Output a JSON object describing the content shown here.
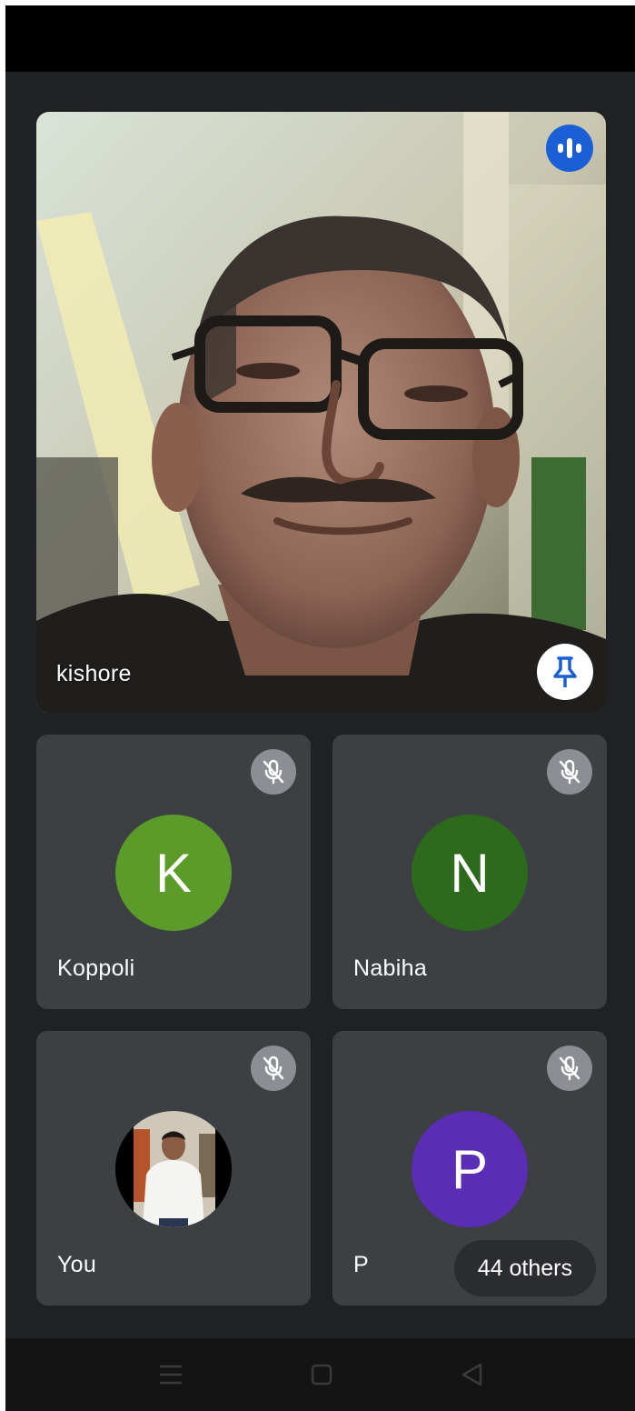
{
  "featured": {
    "name": "kishore",
    "speaking_icon": "audio-wave-icon",
    "pin_icon": "pin-icon"
  },
  "participants": [
    {
      "name": "Koppoli",
      "initial": "K",
      "avatar_color": "#5b9b2a",
      "muted_icon": "mic-off-icon"
    },
    {
      "name": "Nabiha",
      "initial": "N",
      "avatar_color": "#2d6a1c",
      "muted_icon": "mic-off-icon"
    },
    {
      "name": "You",
      "initial": "",
      "avatar_color": "#000000",
      "muted_icon": "mic-off-icon"
    },
    {
      "name": "P",
      "initial": "P",
      "avatar_color": "#5a2db4",
      "muted_icon": "mic-off-icon"
    }
  ],
  "others_chip": {
    "label": "44 others"
  },
  "nav": {
    "menu_icon": "recent-apps-icon",
    "home_icon": "home-icon",
    "back_icon": "back-icon"
  },
  "colors": {
    "background": "#202124",
    "tile": "#3c4043",
    "speaking_accent": "#1a5fd6"
  }
}
